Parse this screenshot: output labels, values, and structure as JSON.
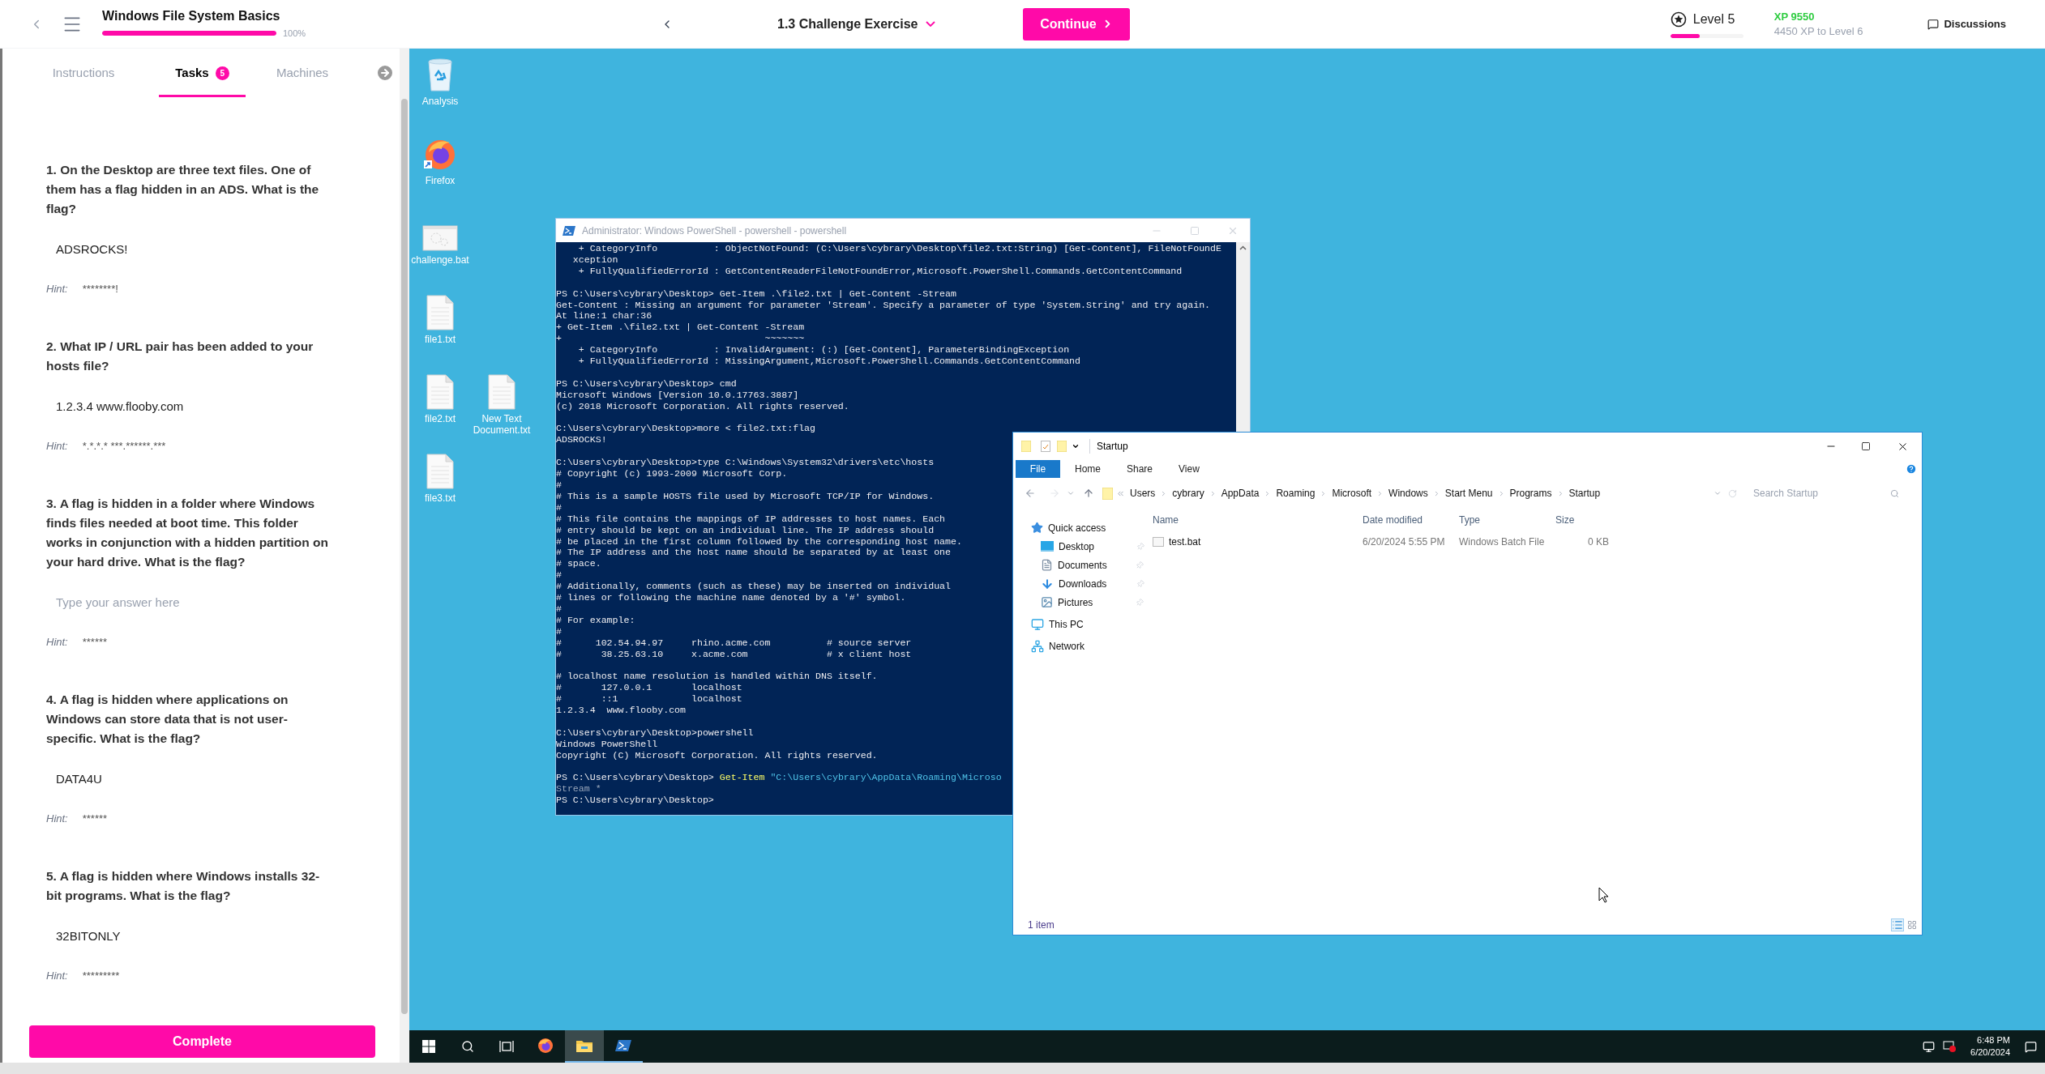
{
  "top_bar": {
    "course_title": "Windows File System Basics",
    "course_progress": {
      "level": 1,
      "reading": "100%"
    },
    "lesson_title": "1.3 Challenge Exercise",
    "continue_button": "Continue",
    "level_label": "Level 5",
    "level_progress": {
      "level": 0.4
    },
    "xp": "XP 9550",
    "xp_to_next": "4450 XP to Level 6",
    "discussions": "Discussions"
  },
  "sidebar": {
    "tabs": [
      {
        "label": "Instructions",
        "selected": false
      },
      {
        "label": "Tasks",
        "selected": true,
        "badge": "5"
      },
      {
        "label": "Machines",
        "selected": false
      }
    ],
    "tasks": [
      {
        "question": "1. On the Desktop are three text files. One of them has a flag hidden in an ADS. What is the flag?",
        "answer": "ADSROCKS!",
        "hint_label": "Hint:",
        "hint": "********!"
      },
      {
        "question": "2. What IP / URL pair has been added to your hosts file?",
        "answer": "1.2.3.4 www.flooby.com",
        "hint_label": "Hint:",
        "hint": "*.*.*.* ***.******.***"
      },
      {
        "question": "3. A flag is hidden in a folder where Windows finds files needed at boot time. This folder works in conjunction with a hidden partition on your hard drive. What is the flag?",
        "placeholder": "Type your answer here",
        "hint_label": "Hint:",
        "hint": "******"
      },
      {
        "question": "4. A flag is hidden where applications on Windows can store data that is not user-specific. What is the flag?",
        "answer": "DATA4U",
        "hint_label": "Hint:",
        "hint": "******"
      },
      {
        "question": "5. A flag is hidden where Windows installs 32-bit programs. What is the flag?",
        "answer": "32BITONLY",
        "hint_label": "Hint:",
        "hint": "*********"
      }
    ],
    "complete_button": "Complete"
  },
  "desktop": {
    "icons": [
      {
        "label": "Analysis",
        "kind": "recycle-bin"
      },
      {
        "label": "Firefox",
        "kind": "firefox"
      },
      {
        "label": "challenge.bat",
        "kind": "batch"
      },
      {
        "label": "file1.txt",
        "kind": "text"
      },
      {
        "label": "file2.txt",
        "kind": "text"
      },
      {
        "label": "New Text Document.txt",
        "kind": "text"
      },
      {
        "label": "file3.txt",
        "kind": "text"
      }
    ]
  },
  "powershell": {
    "title": "Administrator: Windows PowerShell - powershell - powershell",
    "blocks": [
      [
        "    + CategoryInfo          : ObjectNotFound: (C:\\Users\\cybrary\\Desktop\\file2.txt:String) [Get-Content], FileNotFoundE",
        "   xception",
        "    + FullyQualifiedErrorId : GetContentReaderFileNotFoundError,Microsoft.PowerShell.Commands.GetContentCommand"
      ],
      [
        "PS C:\\Users\\cybrary\\Desktop> Get-Item .\\file2.txt | Get-Content -Stream",
        "Get-Content : Missing an argument for parameter 'Stream'. Specify a parameter of type 'System.String' and try again.",
        "At line:1 char:36",
        "+ Get-Item .\\file2.txt | Get-Content -Stream",
        "+                                    ~~~~~~~",
        "    + CategoryInfo          : InvalidArgument: (:) [Get-Content], ParameterBindingException",
        "    + FullyQualifiedErrorId : MissingArgument,Microsoft.PowerShell.Commands.GetContentCommand"
      ],
      [
        "PS C:\\Users\\cybrary\\Desktop> cmd",
        "Microsoft Windows [Version 10.0.17763.3887]",
        "(c) 2018 Microsoft Corporation. All rights reserved."
      ],
      [
        "C:\\Users\\cybrary\\Desktop>more < file2.txt:flag",
        "ADSROCKS!"
      ],
      [
        "C:\\Users\\cybrary\\Desktop>type C:\\Windows\\System32\\drivers\\etc\\hosts",
        "# Copyright (c) 1993-2009 Microsoft Corp.",
        "#",
        "# This is a sample HOSTS file used by Microsoft TCP/IP for Windows.",
        "#",
        "# This file contains the mappings of IP addresses to host names. Each",
        "# entry should be kept on an individual line. The IP address should",
        "# be placed in the first column followed by the corresponding host name.",
        "# The IP address and the host name should be separated by at least one",
        "# space.",
        "#",
        "# Additionally, comments (such as these) may be inserted on individual",
        "# lines or following the machine name denoted by a '#' symbol.",
        "#",
        "# For example:",
        "#",
        "#      102.54.94.97     rhino.acme.com          # source server",
        "#       38.25.63.10     x.acme.com              # x client host"
      ],
      [
        "# localhost name resolution is handled within DNS itself.",
        "#       127.0.0.1       localhost",
        "#       ::1             localhost",
        "1.2.3.4  www.flooby.com"
      ],
      [
        "C:\\Users\\cybrary\\Desktop>powershell",
        "Windows PowerShell",
        "Copyright (C) Microsoft Corporation. All rights reserved."
      ]
    ],
    "last_command": {
      "prompt": "PS C:\\Users\\cybrary\\Desktop>",
      "command": "Get-Item",
      "argument": "\"C:\\Users\\cybrary\\AppData\\Roaming\\Microso"
    },
    "continuation": "Stream *",
    "final_prompt": "PS C:\\Users\\cybrary\\Desktop>"
  },
  "explorer": {
    "title": "Startup",
    "ribbon_tabs": [
      {
        "label": "File",
        "selected": true
      },
      {
        "label": "Home",
        "selected": false
      },
      {
        "label": "Share",
        "selected": false
      },
      {
        "label": "View",
        "selected": false
      }
    ],
    "breadcrumb": [
      "Users",
      "cybrary",
      "AppData",
      "Roaming",
      "Microsoft",
      "Windows",
      "Start Menu",
      "Programs",
      "Startup"
    ],
    "search": {
      "placeholder": "Search Startup"
    },
    "nav": [
      {
        "label": "Quick access",
        "kind": "quick-access",
        "children": [
          {
            "label": "Desktop",
            "kind": "desktop",
            "pinned": true
          },
          {
            "label": "Documents",
            "kind": "documents",
            "pinned": true
          },
          {
            "label": "Downloads",
            "kind": "downloads",
            "pinned": true
          },
          {
            "label": "Pictures",
            "kind": "pictures",
            "pinned": true
          }
        ]
      },
      {
        "label": "This PC",
        "kind": "pc"
      },
      {
        "label": "Network",
        "kind": "network"
      }
    ],
    "columns": [
      "Name",
      "Date modified",
      "Type",
      "Size"
    ],
    "rows": [
      {
        "name": "test.bat",
        "date": "6/20/2024 5:55 PM",
        "type": "Windows Batch File",
        "size": "0 KB"
      }
    ],
    "status": "1 item"
  },
  "taskbar": {
    "apps": [
      {
        "kind": "firefox",
        "running": false,
        "selected": false
      },
      {
        "kind": "explorer",
        "running": true,
        "selected": true
      },
      {
        "kind": "powershell",
        "running": true,
        "selected": false
      }
    ],
    "time": "6:48 PM",
    "date": "6/20/2024"
  }
}
